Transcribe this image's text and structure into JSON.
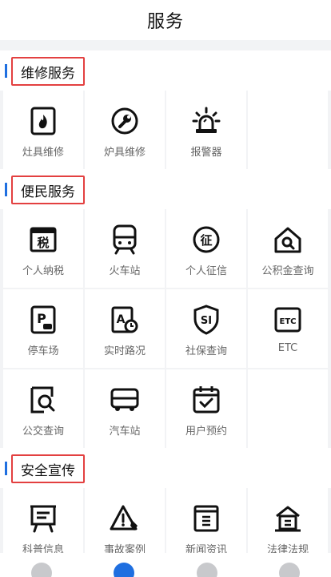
{
  "header": {
    "title": "服务"
  },
  "sections": [
    {
      "title": "维修服务",
      "items": [
        {
          "label": "灶具维修",
          "icon": "stove-fire-icon"
        },
        {
          "label": "炉具维修",
          "icon": "wrench-icon"
        },
        {
          "label": "报警器",
          "icon": "alarm-light-icon"
        }
      ]
    },
    {
      "title": "便民服务",
      "items": [
        {
          "label": "个人纳税",
          "icon": "tax-icon",
          "glyph": "税"
        },
        {
          "label": "火车站",
          "icon": "train-icon"
        },
        {
          "label": "个人征信",
          "icon": "credit-icon",
          "glyph": "征"
        },
        {
          "label": "公积金查询",
          "icon": "house-search-icon"
        },
        {
          "label": "停车场",
          "icon": "parking-icon",
          "glyph": "P"
        },
        {
          "label": "实时路况",
          "icon": "traffic-icon",
          "glyph": "A"
        },
        {
          "label": "社保查询",
          "icon": "social-security-icon",
          "glyph": "SI"
        },
        {
          "label": "ETC",
          "icon": "etc-icon",
          "glyph": "ETC"
        },
        {
          "label": "公交查询",
          "icon": "bus-search-icon"
        },
        {
          "label": "汽车站",
          "icon": "bus-icon"
        },
        {
          "label": "用户预约",
          "icon": "calendar-check-icon"
        }
      ]
    },
    {
      "title": "安全宣传",
      "items": [
        {
          "label": "科普信息",
          "icon": "presentation-board-icon"
        },
        {
          "label": "事故案例",
          "icon": "warning-icon"
        },
        {
          "label": "新闻资讯",
          "icon": "news-icon"
        },
        {
          "label": "法律法规",
          "icon": "court-icon"
        }
      ]
    }
  ],
  "tabbar": [
    {
      "icon": "home-icon",
      "active": false
    },
    {
      "icon": "user-icon",
      "active": true
    },
    {
      "icon": "more-icon",
      "active": false
    },
    {
      "icon": "profile-icon",
      "active": false
    }
  ],
  "colors": {
    "accent": "#1f6fe0",
    "highlight_box": "#e34040",
    "icon_stroke": "#111111"
  }
}
